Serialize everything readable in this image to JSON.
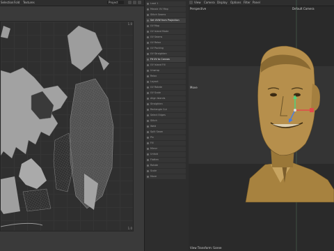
{
  "uv_editor": {
    "menu": [
      "Selection",
      "Fold",
      "Textures"
    ],
    "project_select": "Project",
    "axis_label_top_right": "1.0",
    "axis_label_bottom_right": "1.0"
  },
  "tools": {
    "items": [
      {
        "label": "Load 1",
        "active": false,
        "dark": true
      },
      {
        "label": "Mosaic UV Map",
        "active": false,
        "dark": true
      },
      {
        "label": "Stitch Seams",
        "active": false,
        "dark": true
      },
      {
        "label": "Set UVW from Projection",
        "active": true,
        "dark": false
      },
      {
        "label": "UV Map",
        "active": false,
        "dark": true
      },
      {
        "label": "UV Island Mode",
        "active": false,
        "dark": true
      },
      {
        "label": "UV Seams",
        "active": false,
        "dark": true
      },
      {
        "label": "UV Relax",
        "active": false,
        "dark": true
      },
      {
        "label": "UV Packing",
        "active": false,
        "dark": true
      },
      {
        "label": "UV Straighten",
        "active": false,
        "dark": true
      },
      {
        "label": "Fit UV to Canvas",
        "active": true,
        "dark": false
      },
      {
        "label": "UV Island Fill",
        "active": false,
        "dark": true
      },
      {
        "label": "Unwrap",
        "active": false,
        "dark": true
      },
      {
        "label": "Relax",
        "active": false,
        "dark": true
      },
      {
        "label": "Layout",
        "active": false,
        "dark": true
      },
      {
        "label": "UV Rotate",
        "active": false,
        "dark": true
      },
      {
        "label": "UV Scale",
        "active": false,
        "dark": true
      },
      {
        "label": "Align Islands",
        "active": false,
        "dark": true
      },
      {
        "label": "Straighten",
        "active": false,
        "dark": true
      },
      {
        "label": "Rectangle Cut",
        "active": false,
        "dark": true
      },
      {
        "label": "Select Edges",
        "active": false,
        "dark": true
      },
      {
        "label": "Stitch",
        "active": false,
        "dark": true
      },
      {
        "label": "Weld",
        "active": false,
        "dark": true
      },
      {
        "label": "Split Seam",
        "active": false,
        "dark": true
      },
      {
        "label": "Pin",
        "active": false,
        "dark": true
      },
      {
        "label": "Fill",
        "active": false,
        "dark": true
      },
      {
        "label": "Mirror",
        "active": false,
        "dark": true
      },
      {
        "label": "Unfold",
        "active": false,
        "dark": true
      },
      {
        "label": "Flatten",
        "active": false,
        "dark": true
      },
      {
        "label": "Rotate",
        "active": false,
        "dark": true
      },
      {
        "label": "Scale",
        "active": false,
        "dark": true
      },
      {
        "label": "Move",
        "active": false,
        "dark": true
      }
    ]
  },
  "viewport": {
    "menu": [
      "View",
      "Camera",
      "Display",
      "Options",
      "Filter",
      "Panel"
    ],
    "view_label": "Perspective",
    "camera_label": "Default Camera",
    "move_label": "Move",
    "footer_label": "View Transform: Scene"
  },
  "colors": {
    "bust": "#b08c4a",
    "bust_dark": "#6d5428",
    "axis_y": "#4fd37b",
    "axis_x": "#e04a4a",
    "axis_z": "#4a7de0",
    "uv_island": "#9a9a9a"
  }
}
